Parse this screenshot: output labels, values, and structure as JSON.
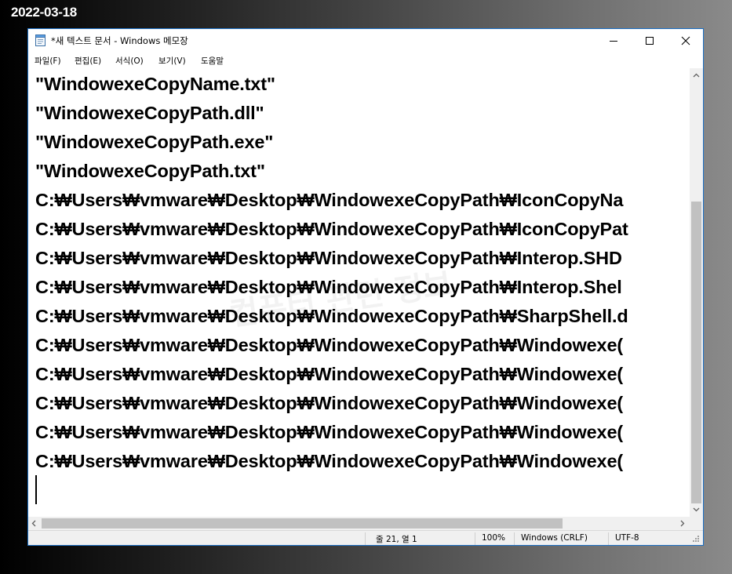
{
  "overlay": {
    "date": "2022-03-18"
  },
  "window": {
    "title": "*새 텍스트 문서 - Windows 메모장",
    "accent_color": "#1c6fc4"
  },
  "icons": {
    "app": "notepad-icon",
    "minimize": "minimize-icon",
    "maximize": "maximize-icon",
    "close": "close-icon"
  },
  "menu": {
    "file": "파일(F)",
    "edit": "편집(E)",
    "format": "서식(O)",
    "view": "보기(V)",
    "help": "도움말"
  },
  "editor": {
    "lines": [
      "\"WindowexeCopyName.txt\"",
      "\"WindowexeCopyPath.dll\"",
      "\"WindowexeCopyPath.exe\"",
      "\"WindowexeCopyPath.txt\"",
      "C:₩Users₩vmware₩Desktop₩WindowexeCopyPath₩IconCopyNa",
      "C:₩Users₩vmware₩Desktop₩WindowexeCopyPath₩IconCopyPat",
      "C:₩Users₩vmware₩Desktop₩WindowexeCopyPath₩Interop.SHD",
      "C:₩Users₩vmware₩Desktop₩WindowexeCopyPath₩Interop.Shel",
      "C:₩Users₩vmware₩Desktop₩WindowexeCopyPath₩SharpShell.d",
      "C:₩Users₩vmware₩Desktop₩WindowexeCopyPath₩Windowexe(",
      "C:₩Users₩vmware₩Desktop₩WindowexeCopyPath₩Windowexe(",
      "C:₩Users₩vmware₩Desktop₩WindowexeCopyPath₩Windowexe(",
      "C:₩Users₩vmware₩Desktop₩WindowexeCopyPath₩Windowexe(",
      "C:₩Users₩vmware₩Desktop₩WindowexeCopyPath₩Windowexe("
    ],
    "watermark": "컴퓨터 관련 정보"
  },
  "status": {
    "position": "줄 21, 열 1",
    "zoom": "100%",
    "line_ending": "Windows (CRLF)",
    "encoding": "UTF-8"
  }
}
